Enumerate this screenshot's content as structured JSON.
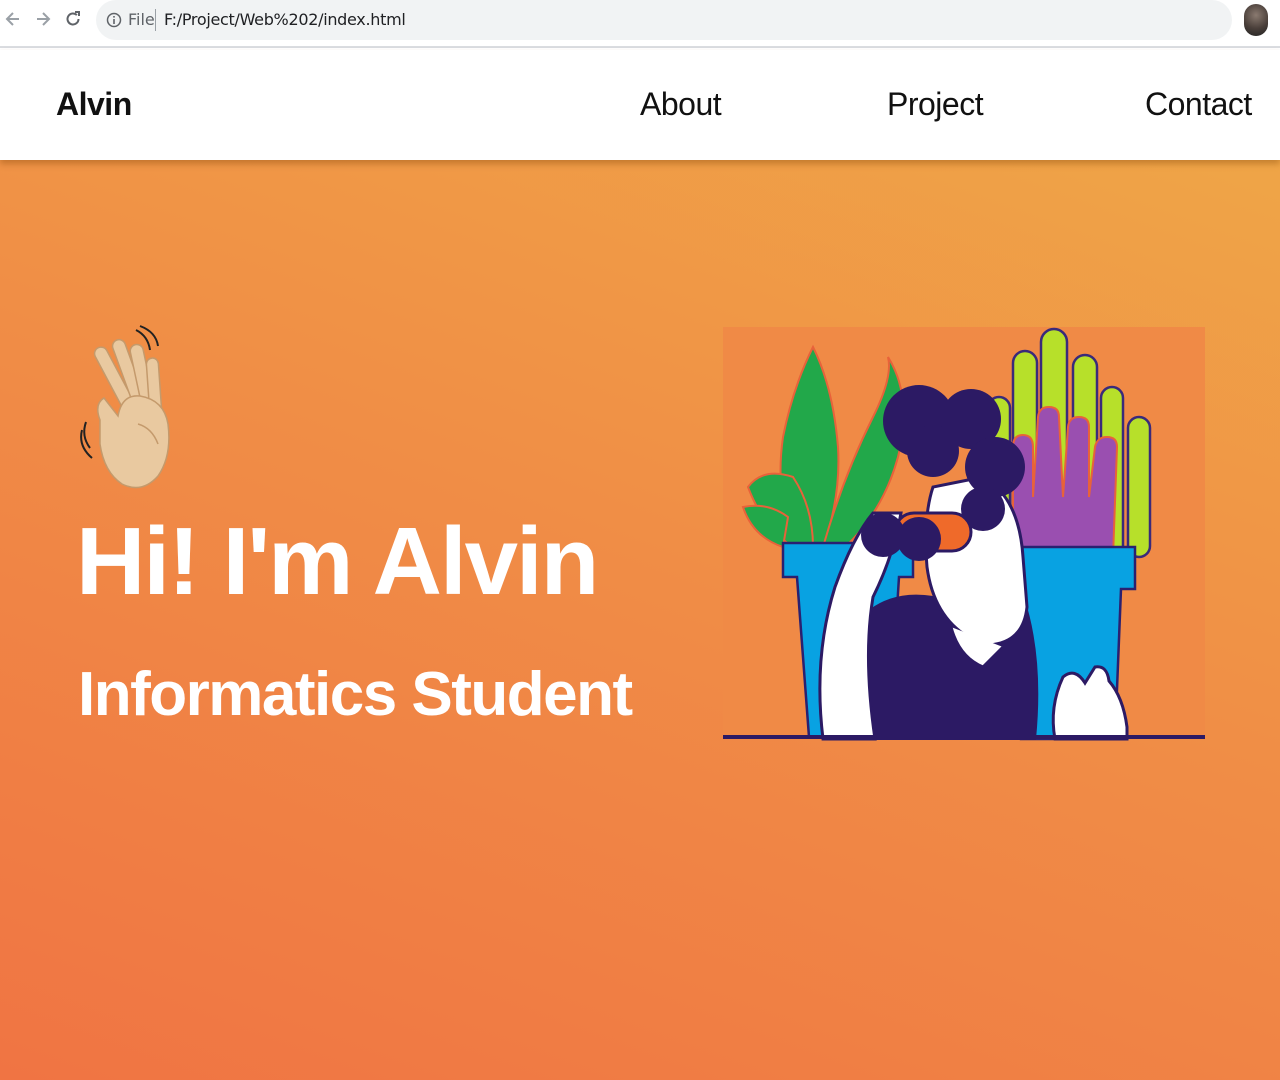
{
  "browser": {
    "file_label": "File",
    "url": "F:/Project/Web%202/index.html"
  },
  "header": {
    "brand": "Alvin",
    "nav": [
      {
        "label": "About"
      },
      {
        "label": "Project"
      },
      {
        "label": "Contact"
      }
    ]
  },
  "hero": {
    "greeting_icon": "waving-hand-icon",
    "title": "Hi! I'm Alvin",
    "subtitle": "Informatics Student",
    "illustration": "person-with-binoculars-and-plants"
  },
  "colors": {
    "gradient_top": "#efa547",
    "gradient_bottom": "#f07443",
    "illustration_bg": "#f08a46",
    "text_on_hero": "#ffffff"
  }
}
